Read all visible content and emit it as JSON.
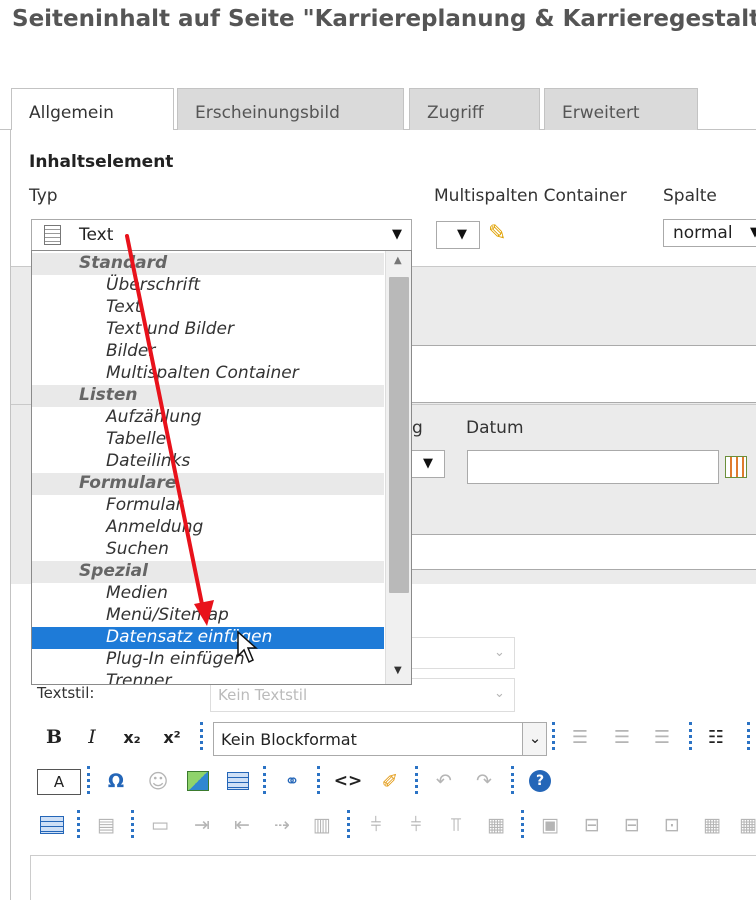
{
  "page": {
    "title": "Seiteninhalt auf Seite \"Karriereplanung & Karrieregestalt"
  },
  "tabs": [
    {
      "label": "Allgemein",
      "active": true
    },
    {
      "label": "Erscheinungsbild",
      "active": false
    },
    {
      "label": "Zugriff",
      "active": false
    },
    {
      "label": "Erweitert",
      "active": false
    }
  ],
  "form": {
    "section_title": "Inhaltselement",
    "type_label": "Typ",
    "type_value": "Text",
    "multicol_label": "Multispalten Container",
    "column_label": "Spalte",
    "column_value": "normal",
    "date_label": "Datum",
    "partial_label": "g",
    "textstyle_label": "Textstil:",
    "textstyle_value": "Kein Textstil",
    "blockformat_value": "Kein Blockformat"
  },
  "dropdown": {
    "groups": [
      {
        "label": "Standard",
        "options": [
          "Überschrift",
          "Text",
          "Text und Bilder",
          "Bilder",
          "Multispalten Container"
        ]
      },
      {
        "label": "Listen",
        "options": [
          "Aufzählung",
          "Tabelle",
          "Dateilinks"
        ]
      },
      {
        "label": "Formulare",
        "options": [
          "Formular",
          "Anmeldung",
          "Suchen"
        ]
      },
      {
        "label": "Spezial",
        "options": [
          "Medien",
          "Menü/Sitemap",
          "Datensatz einfügen",
          "Plug-In einfügen",
          "Trenner"
        ]
      }
    ],
    "selected": "Datensatz einfügen"
  },
  "toolbar": {
    "bold": "B",
    "italic": "I",
    "subscript": "x₂",
    "superscript": "x²",
    "text_color_box": "A",
    "omega": "Ω",
    "code": "<>"
  },
  "colors": {
    "accent": "#1e7bd8",
    "annotation_arrow": "#e8121b",
    "separator": "#2b73c5"
  }
}
